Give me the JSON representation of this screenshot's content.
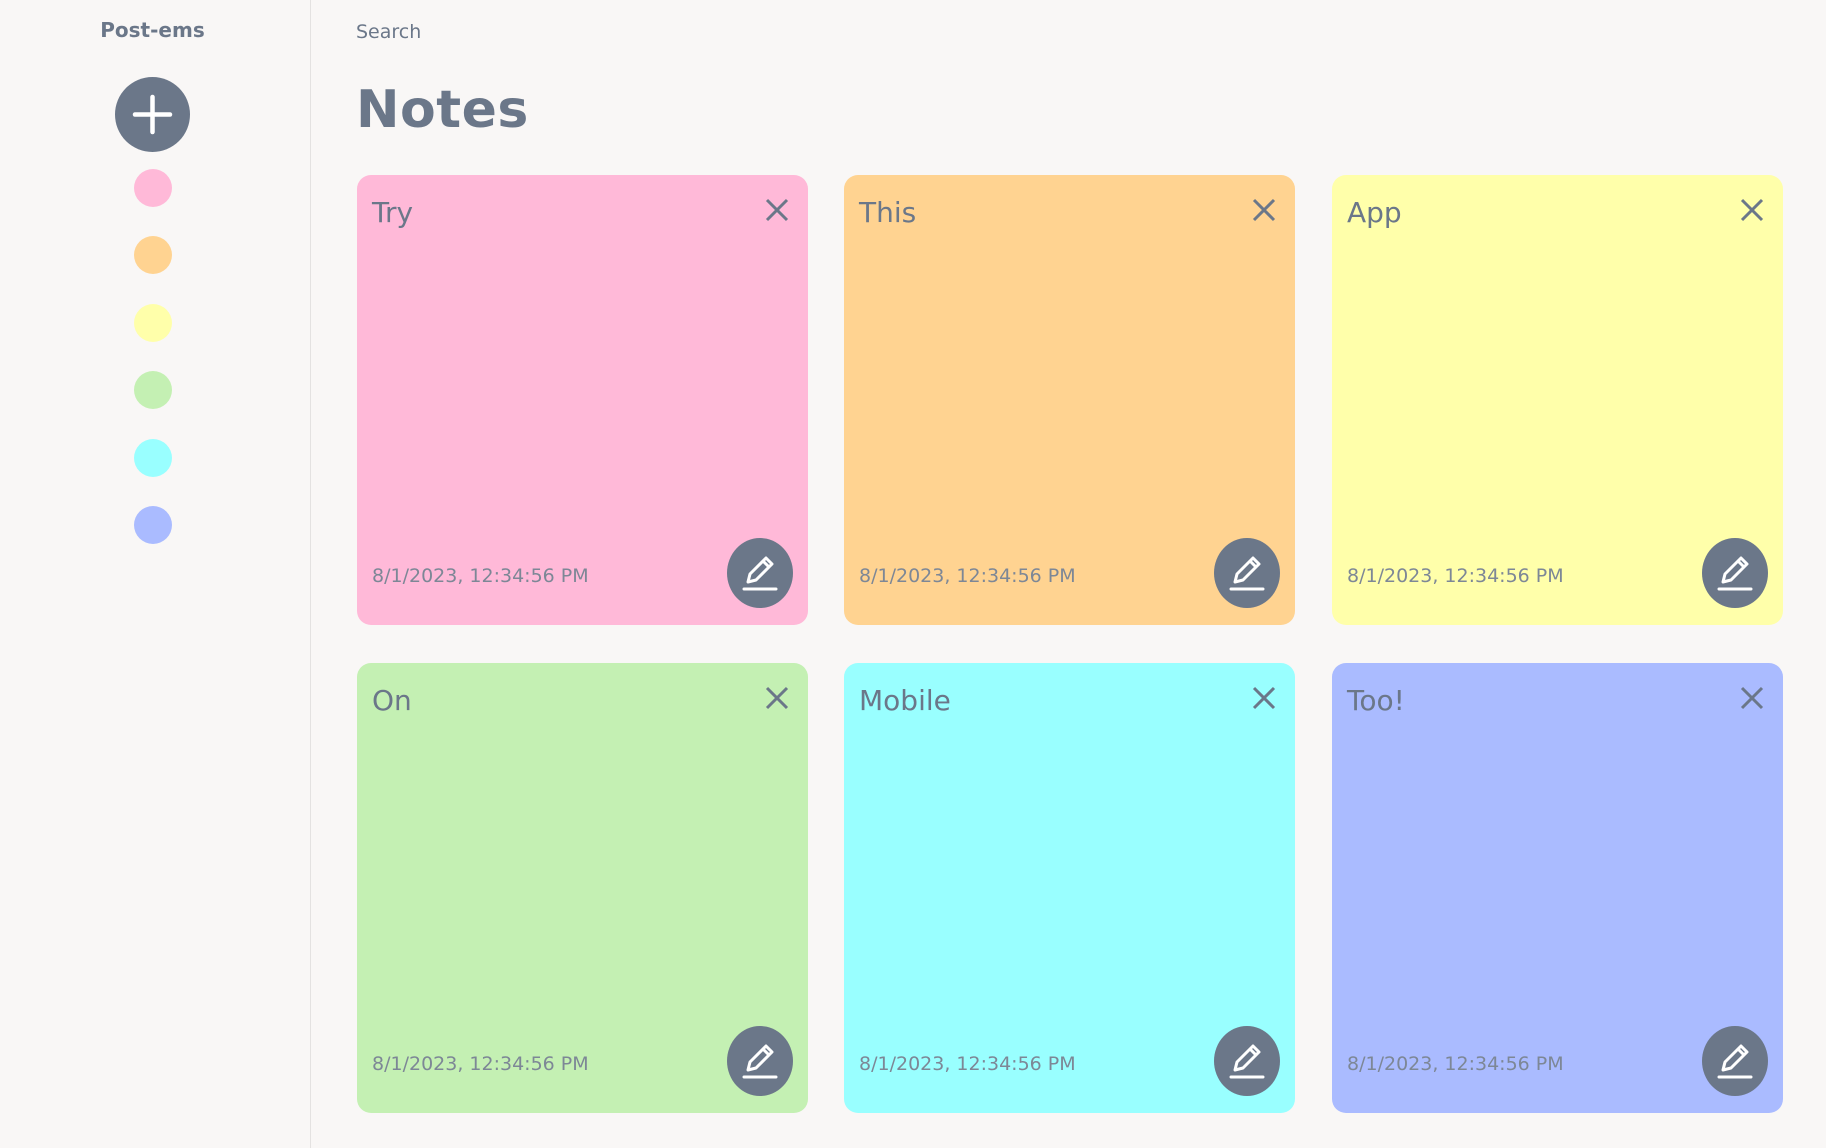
{
  "sidebar": {
    "brand": "Post-ems",
    "add_icon": "plus-icon",
    "colors": [
      "#ffb9d8",
      "#ffd391",
      "#ffffaa",
      "#c4f0b3",
      "#99ffff",
      "#aabbff"
    ]
  },
  "search": {
    "placeholder": "Search",
    "value": ""
  },
  "page": {
    "title": "Notes"
  },
  "notes": [
    {
      "title": "Try",
      "date": "8/1/2023, 12:34:56 PM",
      "color": "#ffb9d8"
    },
    {
      "title": "This",
      "date": "8/1/2023, 12:34:56 PM",
      "color": "#ffd391"
    },
    {
      "title": "App",
      "date": "8/1/2023, 12:34:56 PM",
      "color": "#ffffaa"
    },
    {
      "title": "On",
      "date": "8/1/2023, 12:34:56 PM",
      "color": "#c4f0b3"
    },
    {
      "title": "Mobile",
      "date": "8/1/2023, 12:34:56 PM",
      "color": "#99ffff"
    },
    {
      "title": "Too!",
      "date": "8/1/2023, 12:34:56 PM",
      "color": "#aabbff"
    }
  ],
  "icons": {
    "close": "close-icon",
    "edit": "pencil-icon"
  }
}
